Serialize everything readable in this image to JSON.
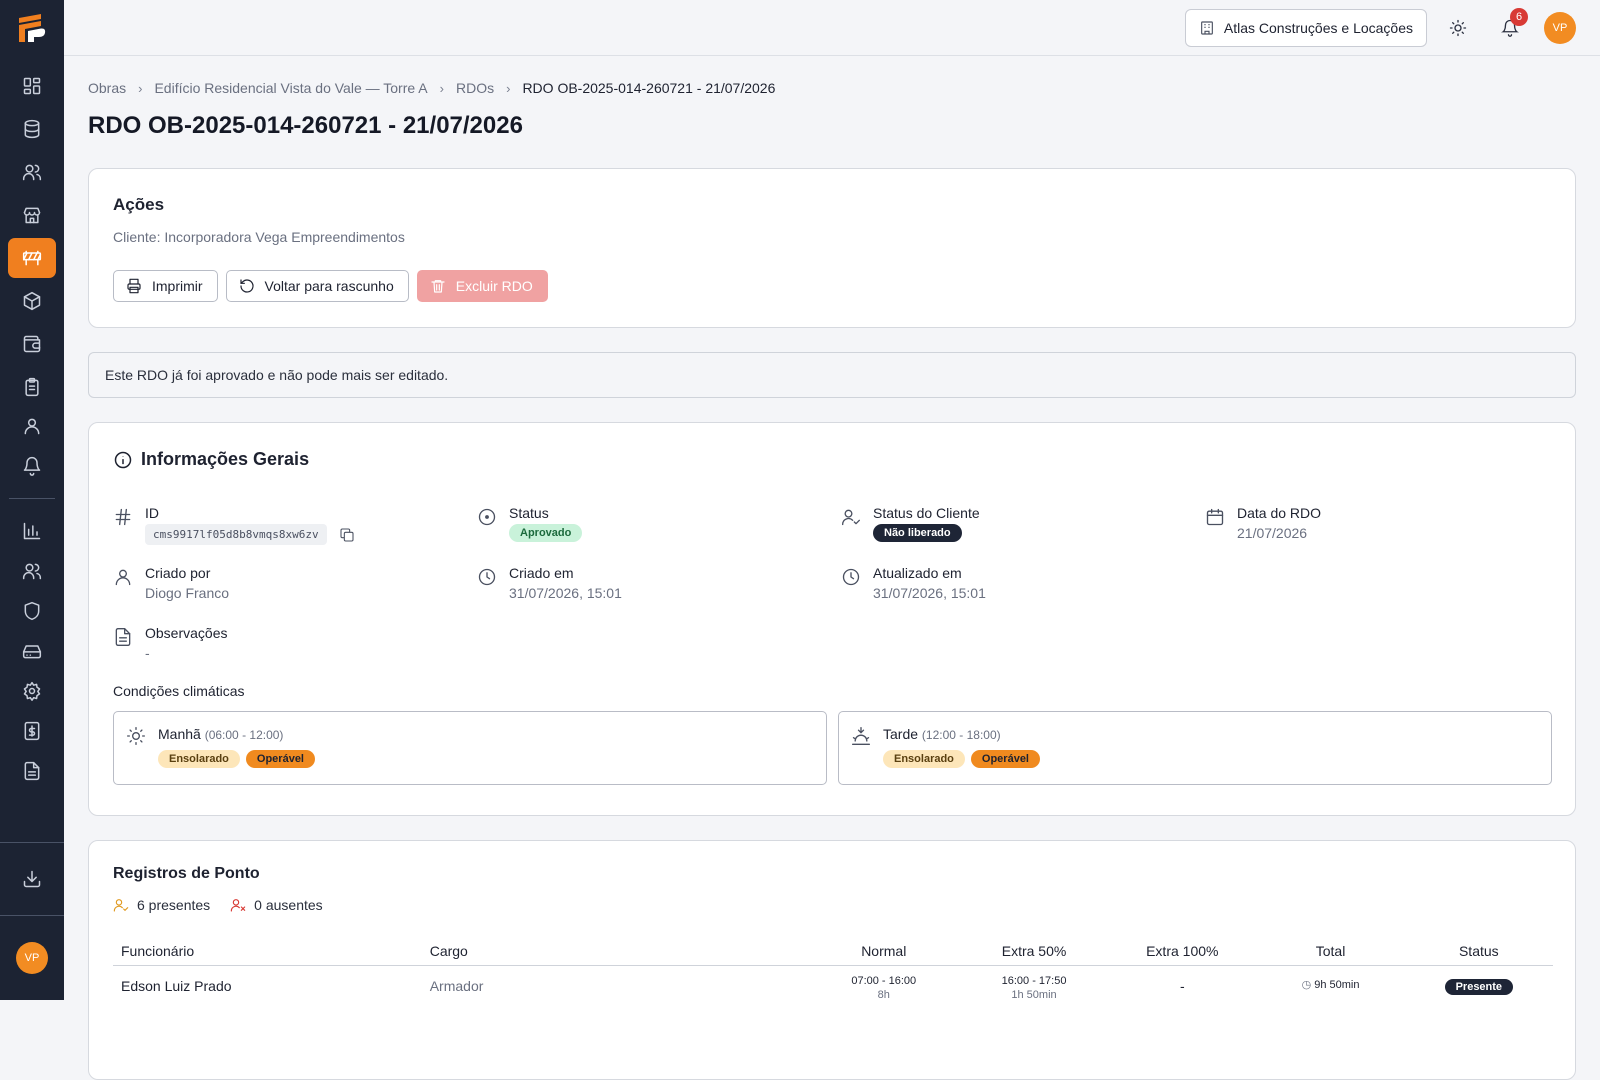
{
  "topbar": {
    "company": "Atlas Construções e Locações",
    "notifications": "6",
    "avatar": "VP"
  },
  "sidebar": {
    "avatar": "VP",
    "items": [
      "dashboard-icon",
      "database-icon",
      "users-icon",
      "store-icon",
      "barrier-icon",
      "package-icon",
      "wallet-icon",
      "clipboard-icon",
      "user-icon",
      "bell-icon",
      "chart-icon",
      "team-icon",
      "shield-icon",
      "drive-icon",
      "gear-icon",
      "invoice-icon",
      "document-icon",
      "download-icon"
    ]
  },
  "breadcrumb": [
    "Obras",
    "Edifício Residencial Vista do Vale — Torre A",
    "RDOs",
    "RDO OB-2025-014-260721 - 21/07/2026"
  ],
  "page_title": "RDO OB-2025-014-260721 - 21/07/2026",
  "actions": {
    "title": "Ações",
    "client": "Cliente: Incorporadora Vega Empreendimentos",
    "print": "Imprimir",
    "draft": "Voltar para rascunho",
    "delete": "Excluir RDO"
  },
  "notice": "Este RDO já foi aprovado e não pode mais ser editado.",
  "info": {
    "title": "Informações Gerais",
    "id_label": "ID",
    "id_value": "cms9917lf05d8b8vmqs8xw6zv",
    "status_label": "Status",
    "status_value": "Aprovado",
    "client_status_label": "Status do Cliente",
    "client_status_value": "Não liberado",
    "date_label": "Data do RDO",
    "date_value": "21/07/2026",
    "created_by_label": "Criado por",
    "created_by_value": "Diogo Franco",
    "created_at_label": "Criado em",
    "created_at_value": "31/07/2026, 15:01",
    "updated_at_label": "Atualizado em",
    "updated_at_value": "31/07/2026, 15:01",
    "notes_label": "Observações",
    "notes_value": "-",
    "weather_label": "Condições climáticas",
    "morning": {
      "name": "Manhã",
      "range": "(06:00 - 12:00)",
      "condition": "Ensolarado",
      "status": "Operável"
    },
    "afternoon": {
      "name": "Tarde",
      "range": "(12:00 - 18:00)",
      "condition": "Ensolarado",
      "status": "Operável"
    }
  },
  "ponto": {
    "title": "Registros de Ponto",
    "present": "6 presentes",
    "absent": "0 ausentes",
    "columns": [
      "Funcionário",
      "Cargo",
      "Normal",
      "Extra 50%",
      "Extra 100%",
      "Total",
      "Status"
    ],
    "rows": [
      {
        "name": "Edson Luiz Prado",
        "role": "Armador",
        "normal": "07:00 - 16:00",
        "normal_dur": "8h",
        "extra50": "16:00 - 17:50",
        "extra50_dur": "1h 50min",
        "extra100": "-",
        "total": "9h 50min",
        "status": "Presente"
      }
    ]
  },
  "colors": {
    "accent": "#f07f1f",
    "sidebar": "#1c2333"
  }
}
